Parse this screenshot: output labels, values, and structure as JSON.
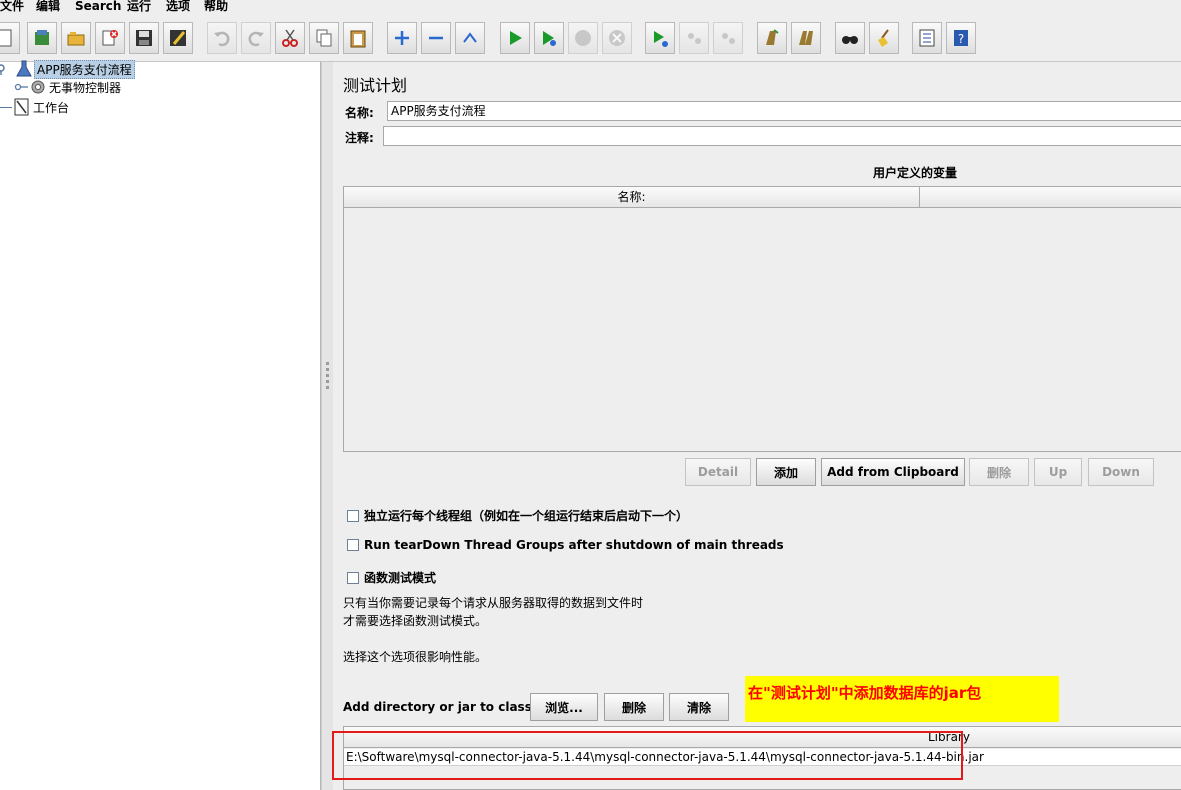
{
  "menu": [
    "文件",
    "编辑",
    "Search",
    "运行",
    "选项",
    "帮助"
  ],
  "toolbar": [
    {
      "name": "new-icon"
    },
    {
      "name": "templates-icon"
    },
    {
      "name": "open-icon"
    },
    {
      "name": "close-icon"
    },
    {
      "name": "save-icon"
    },
    {
      "name": "save-as-icon"
    },
    {
      "name": "undo-icon",
      "disabled": true
    },
    {
      "name": "redo-icon",
      "disabled": true
    },
    {
      "name": "cut-icon"
    },
    {
      "name": "copy-icon"
    },
    {
      "name": "paste-icon"
    },
    {
      "name": "expand-icon"
    },
    {
      "name": "collapse-icon"
    },
    {
      "name": "toggle-icon"
    },
    {
      "name": "start-icon"
    },
    {
      "name": "start-no-pause-icon"
    },
    {
      "name": "stop-icon",
      "disabled": true
    },
    {
      "name": "shutdown-icon",
      "disabled": true
    },
    {
      "name": "remote-start-icon"
    },
    {
      "name": "remote-stop-icon",
      "disabled": true
    },
    {
      "name": "remote-shutdown-icon",
      "disabled": true
    },
    {
      "name": "clear-icon"
    },
    {
      "name": "clear-all-icon"
    },
    {
      "name": "search-icon"
    },
    {
      "name": "reset-search-icon"
    },
    {
      "name": "function-helper-icon"
    },
    {
      "name": "help-icon"
    }
  ],
  "tree": {
    "items": [
      {
        "label": "APP服务支付流程",
        "selected": true,
        "icon": "test-plan-icon"
      },
      {
        "label": "无事物控制器",
        "icon": "gear-icon"
      },
      {
        "label": "工作台",
        "icon": "workbench-icon"
      }
    ]
  },
  "panel": {
    "title": "测试计划",
    "name_label": "名称:",
    "name_value": "APP服务支付流程",
    "comment_label": "注释:",
    "comment_value": "",
    "vars_title": "用户定义的变量",
    "vars_col_name": "名称:",
    "vars_col_value": "",
    "buttons": {
      "detail": "Detail",
      "add": "添加",
      "add_clipboard": "Add from Clipboard",
      "delete": "删除",
      "up": "Up",
      "down": "Down"
    },
    "checkboxes": {
      "serialize": "独立运行每个线程组（例如在一个组运行结束后启动下一个）",
      "teardown": "Run tearDown Thread Groups after shutdown of main threads",
      "functional": "函数测试模式"
    },
    "note_line1": "只有当你需要记录每个请求从服务器取得的数据到文件时",
    "note_line2": "才需要选择函数测试模式。",
    "note_line3": "选择这个选项很影响性能。",
    "classpath_label": "Add directory or jar to classpath",
    "classpath_buttons": {
      "browse": "浏览...",
      "delete": "删除",
      "clear": "清除"
    },
    "library_header": "Library",
    "library_rows": [
      "E:\\Software\\mysql-connector-java-5.1.44\\mysql-connector-java-5.1.44\\mysql-connector-java-5.1.44-bin.jar"
    ]
  },
  "annotation": {
    "text": "在\"测试计划\"中添加数据库的jar包",
    "bg_color": "#ffff00",
    "text_color": "#ff0000",
    "box_color": "#e21a1a"
  }
}
